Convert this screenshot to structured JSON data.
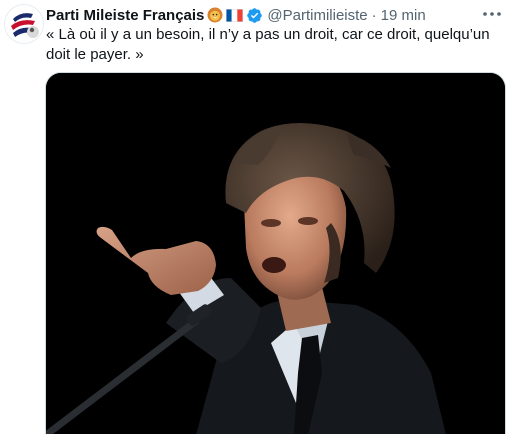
{
  "tweet": {
    "display_name": "Parti Mileiste Français",
    "handle": "@Partimilieiste",
    "separator": "·",
    "timestamp": "19 min",
    "text": "« Là où il y a un besoin, il n’y a pas un droit, car ce droit, quelqu’un doit le payer. »"
  },
  "icons": {
    "avatar": "party-logo-avatar",
    "emoji_1": "lion-face-emoji",
    "emoji_2": "flag-france-emoji",
    "verified": "verified-badge-icon",
    "more": "more-options-icon"
  },
  "colors": {
    "accent": "#1d9bf0",
    "text_primary": "#0f1419",
    "text_secondary": "#536471",
    "flag_blue": "#0055a4",
    "flag_red": "#ef4135"
  }
}
